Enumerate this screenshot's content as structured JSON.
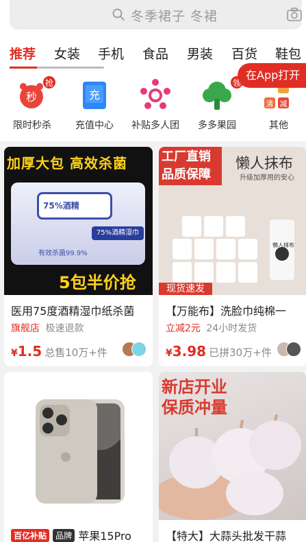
{
  "search": {
    "placeholder": "冬季裙子 冬裙",
    "search_icon": "search-icon",
    "camera_icon": "camera-icon"
  },
  "tabs": [
    {
      "label": "推荐",
      "active": true
    },
    {
      "label": "女装"
    },
    {
      "label": "手机"
    },
    {
      "label": "食品"
    },
    {
      "label": "男装"
    },
    {
      "label": "百货"
    },
    {
      "label": "鞋包"
    }
  ],
  "app_button": {
    "label": "在App打开",
    "arrow": "❯"
  },
  "shortcuts": [
    {
      "label": "限时秒杀",
      "icon": "flash-sale-clock-icon",
      "badge": "抢",
      "glyph": "秒"
    },
    {
      "label": "充值中心",
      "icon": "recharge-phone-icon",
      "glyph": "充"
    },
    {
      "label": "补贴多人团",
      "icon": "group-buy-icon"
    },
    {
      "label": "多多果园",
      "icon": "orchard-tree-icon",
      "badge": "领"
    },
    {
      "label": "其他",
      "icon": "more-apps-icon",
      "glyphs": [
        "清",
        "减"
      ]
    }
  ],
  "products": [
    {
      "title": "医用75度酒精湿巾纸杀菌",
      "image_text": [
        "加厚大包 高效杀菌",
        "75%酒精",
        "75%酒精湿巾",
        "有效杀菌99.9%",
        "5包半价抢"
      ],
      "tag1": "旗舰店",
      "tag2": "极速退款",
      "yen": "¥",
      "price": "1.5",
      "sold": "总售10万+件"
    },
    {
      "title": "【万能布】洗脸巾纯棉一",
      "image_text": [
        "工厂直销",
        "品质保障",
        "懒人抹布",
        "升级加厚用的安心",
        "现货速发",
        "懒人抹布"
      ],
      "tag1": "立减2元",
      "tag2": "24小时发货",
      "yen": "¥",
      "price": "3.98",
      "sold": "已拼30万+件"
    },
    {
      "title": "苹果15Pro",
      "badge1": "百亿补贴",
      "badge2": "品牌"
    },
    {
      "title": "【特大】大蒜头批发干蒜",
      "image_text": [
        "新店开业",
        "保质冲量"
      ]
    }
  ],
  "colors": {
    "accent": "#e02e24",
    "background": "#f2f2f2"
  }
}
